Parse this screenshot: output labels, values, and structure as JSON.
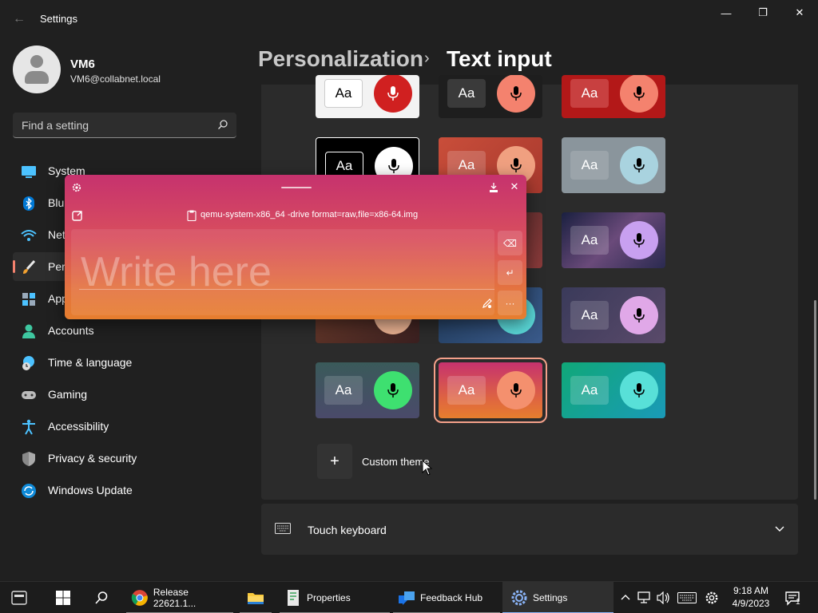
{
  "window": {
    "title": "Settings",
    "back_glyph": "←",
    "minimize_glyph": "—",
    "maximize_glyph": "❐",
    "close_glyph": "✕"
  },
  "profile": {
    "name": "VM6",
    "email": "VM6@collabnet.local"
  },
  "search": {
    "placeholder": "Find a setting"
  },
  "nav": {
    "items": [
      {
        "label": "System",
        "icon": "monitor-icon"
      },
      {
        "label": "Blu",
        "icon": "bluetooth-icon"
      },
      {
        "label": "Net",
        "icon": "network-icon"
      },
      {
        "label": "Per",
        "icon": "brush-icon"
      },
      {
        "label": "App",
        "icon": "apps-icon"
      },
      {
        "label": "Accounts",
        "icon": "person-icon"
      },
      {
        "label": "Time & language",
        "icon": "globe-clock-icon"
      },
      {
        "label": "Gaming",
        "icon": "gamepad-icon"
      },
      {
        "label": "Accessibility",
        "icon": "accessibility-icon"
      },
      {
        "label": "Privacy & security",
        "icon": "shield-icon"
      },
      {
        "label": "Windows Update",
        "icon": "update-icon"
      }
    ]
  },
  "breadcrumb": {
    "parent": "Personalization",
    "separator": "›",
    "current": "Text input"
  },
  "themes": {
    "aa_label": "Aa",
    "colors": {
      "selected_outline": "#f4a08a"
    }
  },
  "custom_theme": {
    "plus": "+",
    "label": "Custom theme"
  },
  "touch_keyboard": {
    "label": "Touch keyboard"
  },
  "writepad": {
    "command": "qemu-system-x86_64 -drive format=raw,file=x86-64.img",
    "placeholder": "Write here",
    "close_glyph": "✕",
    "backspace_glyph": "⌫",
    "enter_glyph": "↵",
    "more_glyph": "···"
  },
  "taskbar": {
    "apps": [
      {
        "label": "Release 22621.1...",
        "icon": "chrome-icon"
      },
      {
        "label": "",
        "icon": "file-explorer-icon"
      },
      {
        "label": "Properties",
        "icon": "properties-icon"
      },
      {
        "label": "Feedback Hub",
        "icon": "feedback-hub-icon"
      },
      {
        "label": "Settings",
        "icon": "settings-icon"
      }
    ],
    "time": "9:18 AM",
    "date": "4/9/2023",
    "notification_count": "1"
  }
}
